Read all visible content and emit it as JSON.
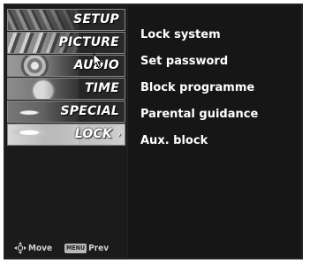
{
  "sidebar": {
    "items": [
      {
        "label": "SETUP",
        "icon": "setup-thumbnail-icon"
      },
      {
        "label": "PICTURE",
        "icon": "picture-thumbnail-icon"
      },
      {
        "label": "AUDIO",
        "icon": "audio-thumbnail-icon"
      },
      {
        "label": "TIME",
        "icon": "time-thumbnail-icon"
      },
      {
        "label": "SPECIAL",
        "icon": "special-thumbnail-icon"
      },
      {
        "label": "LOCK",
        "icon": "lock-thumbnail-icon",
        "active": true
      }
    ],
    "active_arrow": "›"
  },
  "help": {
    "move_label": "Move",
    "menu_key": "MENU",
    "prev_label": "Prev"
  },
  "lock_menu": {
    "options": [
      "Lock system",
      "Set password",
      "Block programme",
      "Parental guidance",
      "Aux. block"
    ]
  },
  "colors": {
    "background": "#222222",
    "panel": "#161616",
    "text": "#ffffff",
    "active_item": "#d0d0d0"
  }
}
